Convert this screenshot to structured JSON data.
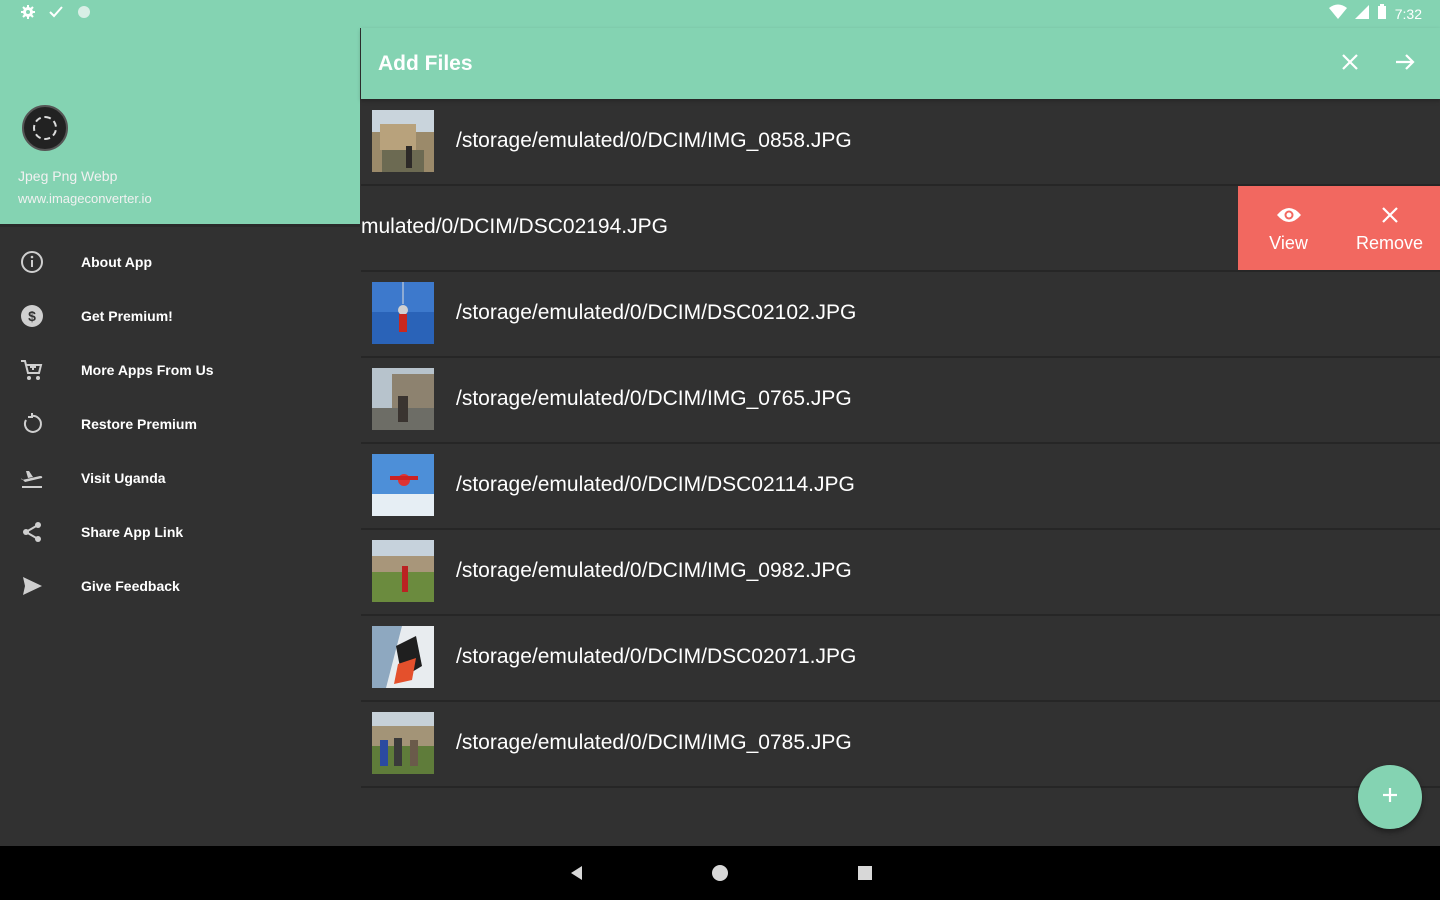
{
  "status_bar": {
    "time": "7:32",
    "left_icons": [
      "settings-icon",
      "check-icon",
      "circle-icon"
    ],
    "right_icons": [
      "wifi-icon",
      "signal-icon",
      "battery-icon"
    ]
  },
  "drawer": {
    "app_name": "Jpeg Png Webp",
    "website": "www.imageconverter.io",
    "menu": [
      {
        "label": "About App",
        "icon": "info-icon"
      },
      {
        "label": "Get Premium!",
        "icon": "dollar-icon"
      },
      {
        "label": "More Apps From Us",
        "icon": "cart-icon"
      },
      {
        "label": "Restore Premium",
        "icon": "restore-icon"
      },
      {
        "label": "Visit Uganda",
        "icon": "plane-icon"
      },
      {
        "label": "Share App Link",
        "icon": "share-icon"
      },
      {
        "label": "Give Feedback",
        "icon": "send-icon"
      }
    ]
  },
  "appbar": {
    "title": "Add Files",
    "close_icon": "close-icon",
    "next_icon": "arrow-right-icon"
  },
  "files": [
    {
      "path": "/storage/emulated/0/DCIM/IMG_0858.JPG"
    },
    {
      "path": "mulated/0/DCIM/DSC02194.JPG",
      "swiped": true
    },
    {
      "path": "/storage/emulated/0/DCIM/DSC02102.JPG"
    },
    {
      "path": "/storage/emulated/0/DCIM/IMG_0765.JPG"
    },
    {
      "path": "/storage/emulated/0/DCIM/DSC02114.JPG"
    },
    {
      "path": "/storage/emulated/0/DCIM/IMG_0982.JPG"
    },
    {
      "path": "/storage/emulated/0/DCIM/DSC02071.JPG"
    },
    {
      "path": "/storage/emulated/0/DCIM/IMG_0785.JPG"
    }
  ],
  "swipe_actions": {
    "view_label": "View",
    "remove_label": "Remove"
  },
  "colors": {
    "accent": "#84d3b2",
    "background": "#313131",
    "danger": "#f26860"
  }
}
